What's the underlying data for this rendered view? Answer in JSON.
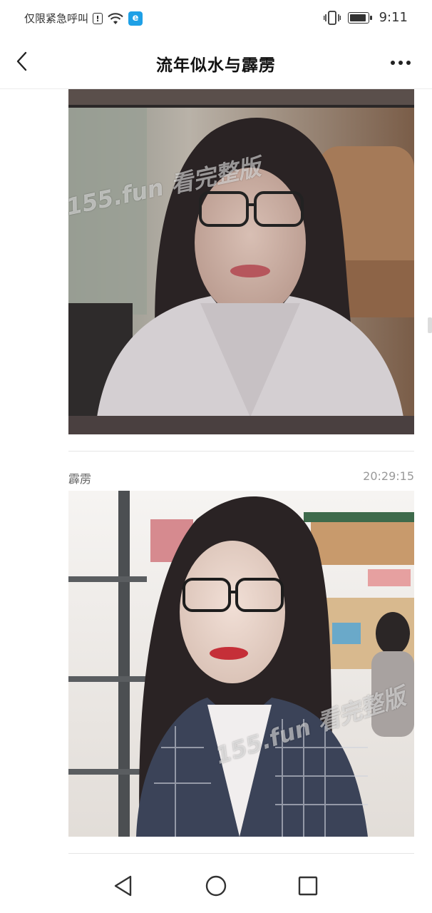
{
  "status_bar": {
    "carrier_text": "仅限紧急呼叫",
    "alert_badge": "!",
    "app_badge": "e",
    "icons": [
      "alert-icon",
      "wifi-icon",
      "app-notification-icon",
      "vibrate-icon",
      "battery-icon"
    ],
    "time": "9:11"
  },
  "nav": {
    "title": "流年似水与霹雳",
    "back_icon": "chevron-left-icon",
    "more_icon": "more-horizontal-icon"
  },
  "messages": [
    {
      "type": "image",
      "image_description_icon": "photo-image",
      "watermark": "155.fun 看完整版"
    },
    {
      "sender": "霹雳",
      "time": "20:29:15",
      "type": "image",
      "watermark": "155.fun 看完整版"
    }
  ],
  "system_nav": {
    "back_icon": "triangle-back-icon",
    "home_icon": "circle-home-icon",
    "recents_icon": "square-recents-icon"
  },
  "colors": {
    "background": "#ffffff",
    "title": "#111111",
    "secondary_text": "#999999",
    "divider": "#e6e6e6",
    "app_badge": "#1ea0e6"
  }
}
